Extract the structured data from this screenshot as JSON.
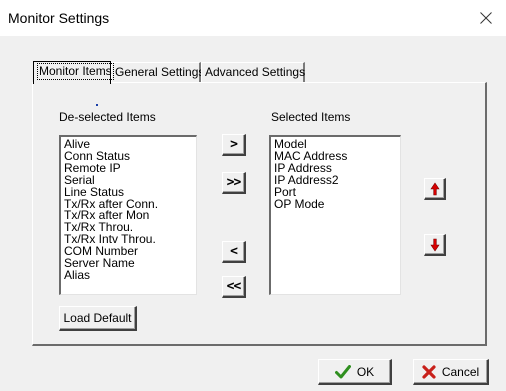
{
  "window": {
    "title": "Monitor Settings",
    "close_icon": "close-icon"
  },
  "tabs": [
    {
      "label": "Monitor Items",
      "active": true
    },
    {
      "label": "General Settings",
      "active": false
    },
    {
      "label": "Advanced Settings",
      "active": false
    }
  ],
  "deselected": {
    "heading": "De-selected Items",
    "items": [
      "Alive",
      "Conn Status",
      "Remote IP",
      "Serial",
      "Line Status",
      "Tx/Rx after Conn.",
      "Tx/Rx after Mon",
      "Tx/Rx Throu.",
      "Tx/Rx Intv Throu.",
      "COM Number",
      "Server Name",
      "Alias"
    ]
  },
  "selected": {
    "heading": "Selected Items",
    "items": [
      "Model",
      "MAC Address",
      "IP Address",
      "IP Address2",
      "Port",
      "OP Mode"
    ]
  },
  "move_buttons": {
    "add": ">",
    "add_all": ">>",
    "remove": "<",
    "remove_all": "<<"
  },
  "order_buttons": {
    "up_icon": "arrow-up-icon",
    "down_icon": "arrow-down-icon",
    "arrow_color": "#d60000"
  },
  "load_default_label": "Load Default",
  "footer": {
    "ok_label": "OK",
    "cancel_label": "Cancel",
    "ok_icon": "checkmark-icon",
    "cancel_icon": "x-icon",
    "ok_color": "#2f8f1f",
    "cancel_color": "#c8201a"
  }
}
